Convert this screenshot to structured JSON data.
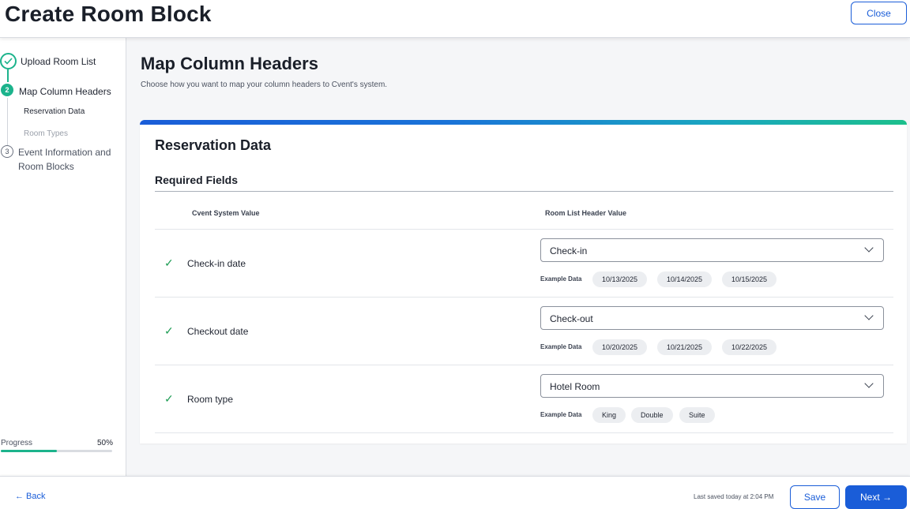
{
  "header": {
    "title": "Create Room Block",
    "close_label": "Close"
  },
  "sidebar": {
    "steps": [
      {
        "number": "",
        "label": "Upload Room List",
        "state": "completed",
        "icon": "check-icon"
      },
      {
        "number": "2",
        "label": "Map Column Headers",
        "state": "current"
      },
      {
        "number": "3",
        "label": "Event Information and Room Blocks",
        "state": "upcoming"
      }
    ],
    "substeps": [
      {
        "label": "Reservation Data",
        "state": "active"
      },
      {
        "label": "Room Types",
        "state": "inactive"
      }
    ],
    "progress": {
      "label": "Progress",
      "value_text": "50%",
      "value": 0.5
    }
  },
  "main": {
    "title": "Map Column Headers",
    "subtitle": "Choose how you want to map your column headers to Cvent's system."
  },
  "card": {
    "title": "Reservation Data",
    "section_title": "Required Fields",
    "col_system": "Cvent System Value",
    "col_header": "Room List Header Value",
    "example_label": "Example Data",
    "rows": [
      {
        "label": "Check-in date",
        "selected": "Check-in",
        "examples": [
          "10/13/2025",
          "10/14/2025",
          "10/15/2025"
        ]
      },
      {
        "label": "Checkout date",
        "selected": "Check-out",
        "examples": [
          "10/20/2025",
          "10/21/2025",
          "10/22/2025"
        ]
      },
      {
        "label": "Room type",
        "selected": "Hotel Room",
        "examples": [
          "King",
          "Double",
          "Suite"
        ]
      }
    ]
  },
  "footer": {
    "back_label": "← Back",
    "saved_text": "Last saved today at 2:04 PM",
    "save_label": "Save",
    "next_label": "Next →"
  },
  "colors": {
    "accent": "#1a5dd8",
    "success": "#1cb38c",
    "check": "#1f9d55"
  }
}
